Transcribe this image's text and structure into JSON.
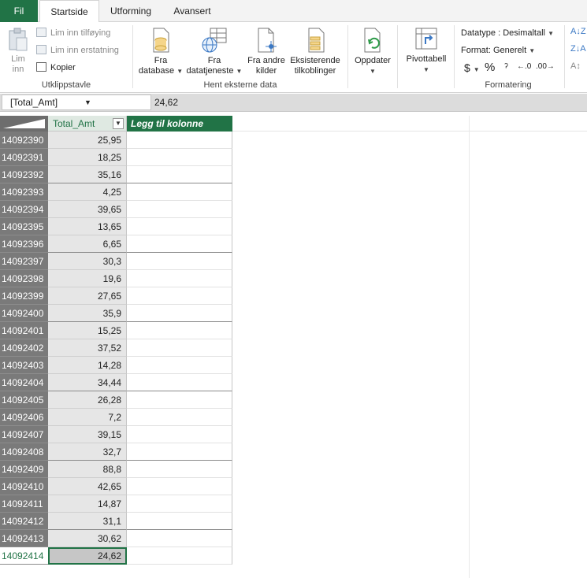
{
  "tabs": [
    {
      "label": "Fil"
    },
    {
      "label": "Startside"
    },
    {
      "label": "Utforming"
    },
    {
      "label": "Avansert"
    }
  ],
  "ribbon": {
    "clipboard": {
      "paste_label_1": "Lim",
      "paste_label_2": "inn",
      "append_label": "Lim inn tilføying",
      "replace_label": "Lim inn erstatning",
      "copy_label": "Kopier",
      "group_label": "Utklippstavle"
    },
    "external": {
      "db_1": "Fra",
      "db_2": "database",
      "svc_1": "Fra",
      "svc_2": "datatjeneste",
      "other_1": "Fra andre",
      "other_2": "kilder",
      "exist_1": "Eksisterende",
      "exist_2": "tilkoblinger",
      "group_label": "Hent eksterne data"
    },
    "refresh_label": "Oppdater",
    "pivot_label": "Pivottabell",
    "formatting": {
      "datatype": "Datatype : Desimaltall",
      "format": "Format: Generelt",
      "currency": "$",
      "percent": "%",
      "comma": "ɂ",
      "inc": ".00 →.0",
      "dec": ".0 →.00",
      "group_label": "Formatering"
    }
  },
  "formula_bar": {
    "name_box": "[Total_Amt]",
    "value": "24,62"
  },
  "grid": {
    "col_total": "Total_Amt",
    "col_add": "Legg til kolonne",
    "rows": [
      {
        "id": "14092390",
        "amt": "25,95"
      },
      {
        "id": "14092391",
        "amt": "18,25"
      },
      {
        "id": "14092392",
        "amt": "35,16"
      },
      {
        "id": "14092393",
        "amt": "4,25"
      },
      {
        "id": "14092394",
        "amt": "39,65"
      },
      {
        "id": "14092395",
        "amt": "13,65"
      },
      {
        "id": "14092396",
        "amt": "6,65"
      },
      {
        "id": "14092397",
        "amt": "30,3"
      },
      {
        "id": "14092398",
        "amt": "19,6"
      },
      {
        "id": "14092399",
        "amt": "27,65"
      },
      {
        "id": "14092400",
        "amt": "35,9"
      },
      {
        "id": "14092401",
        "amt": "15,25"
      },
      {
        "id": "14092402",
        "amt": "37,52"
      },
      {
        "id": "14092403",
        "amt": "14,28"
      },
      {
        "id": "14092404",
        "amt": "34,44"
      },
      {
        "id": "14092405",
        "amt": "26,28"
      },
      {
        "id": "14092406",
        "amt": "7,2"
      },
      {
        "id": "14092407",
        "amt": "39,15"
      },
      {
        "id": "14092408",
        "amt": "32,7"
      },
      {
        "id": "14092409",
        "amt": "88,8"
      },
      {
        "id": "14092410",
        "amt": "42,65"
      },
      {
        "id": "14092411",
        "amt": "14,87"
      },
      {
        "id": "14092412",
        "amt": "31,1"
      },
      {
        "id": "14092413",
        "amt": "30,62"
      },
      {
        "id": "14092414",
        "amt": "24,62"
      }
    ]
  },
  "colors": {
    "accent": "#217346",
    "row_header": "#7a7a7a"
  }
}
